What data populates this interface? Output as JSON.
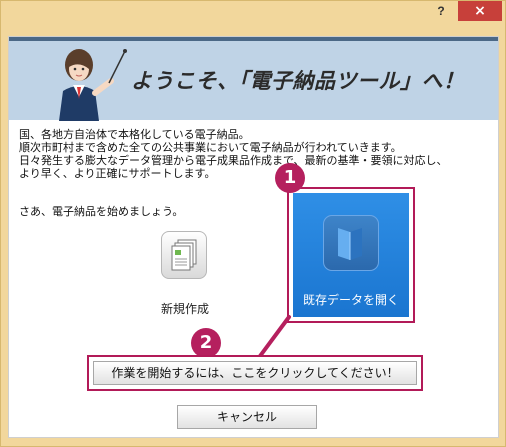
{
  "window": {
    "help_label": "?",
    "close_label": "×"
  },
  "banner": {
    "title": "ようこそ、「電子納品ツール」へ！",
    "mascot_icon": "presenter-woman-icon"
  },
  "intro": {
    "text": "国、各地方自治体で本格化している電子納品。\n順次市町村まで含めた全ての公共事業において電子納品が行われていきます。\n日々発生する膨大なデータ管理から電子成果品作成まで、最新の基準・要領に対応し、\nより早く、より正確にサポートします。"
  },
  "prompt": "さあ、電子納品を始めましょう。",
  "actions": {
    "new": {
      "label": "新規作成",
      "icon": "new-documents-icon"
    },
    "open": {
      "label": "既存データを開く",
      "icon": "open-folder-icon"
    }
  },
  "steps": {
    "one": "1",
    "two": "2"
  },
  "buttons": {
    "start": "作業を開始するには、ここをクリックしてください！",
    "cancel": "キャンセル"
  },
  "colors": {
    "frame": "#f2d79c",
    "banner_bg": "#bfd3e6",
    "banner_stripe": "#4b6886",
    "accent": "#b5205e",
    "open_bg": "#1f7fd8",
    "close_bg": "#c7403a"
  }
}
